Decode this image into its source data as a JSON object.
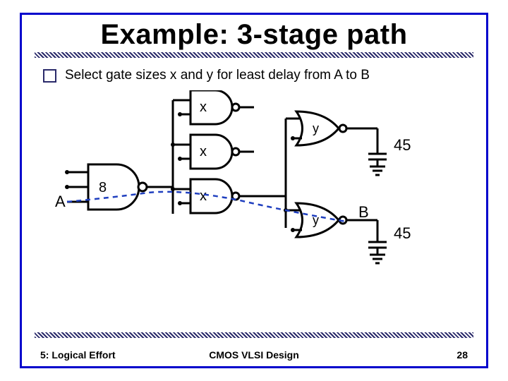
{
  "title": "Example: 3-stage path",
  "bullet": "Select gate sizes x and y for least delay from A to B",
  "footer": {
    "left": "5: Logical Effort",
    "center": "CMOS VLSI Design",
    "right": "28"
  },
  "diagram": {
    "input_label": "A",
    "output_label": "B",
    "stage1": {
      "gate": "NAND3",
      "size_label": "8",
      "count": 1
    },
    "stage2": {
      "gate": "NAND2",
      "size_label": "x",
      "count": 3
    },
    "stage3": {
      "gate": "NOR2",
      "size_label": "y",
      "count": 2
    },
    "loads": [
      {
        "value": "45"
      },
      {
        "value": "45"
      }
    ],
    "critical_path": "A → stage1 → bottom stage2 NAND → bottom stage3 NOR → B"
  }
}
